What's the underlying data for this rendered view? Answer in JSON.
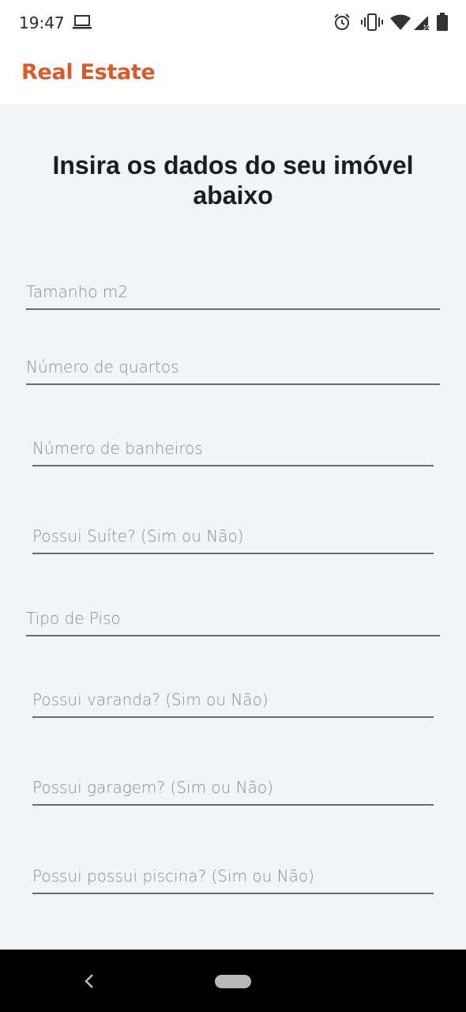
{
  "status_bar": {
    "time": "19:47",
    "icons": [
      "laptop-icon",
      "alarm-icon",
      "vibrate-icon",
      "wifi-icon",
      "signal-icon",
      "battery-icon"
    ]
  },
  "app_bar": {
    "title": "Real Estate",
    "title_color": "#d95a2b"
  },
  "form": {
    "heading": "Insira os dados do seu imóvel abaixo",
    "fields": [
      {
        "placeholder": "Tamanho m2",
        "value": ""
      },
      {
        "placeholder": "Número de quartos",
        "value": ""
      },
      {
        "placeholder": "Número de banheiros",
        "value": ""
      },
      {
        "placeholder": "Possui Suíte? (Sim ou Não)",
        "value": ""
      },
      {
        "placeholder": "Tipo de Piso",
        "value": ""
      },
      {
        "placeholder": "Possui varanda? (Sim ou Não)",
        "value": ""
      },
      {
        "placeholder": "Possui garagem? (Sim ou Não)",
        "value": ""
      },
      {
        "placeholder": "Possui possui piscina? (Sim ou Não)",
        "value": ""
      }
    ]
  },
  "nav_bar": {
    "icons": [
      "back-icon",
      "home-pill"
    ]
  }
}
